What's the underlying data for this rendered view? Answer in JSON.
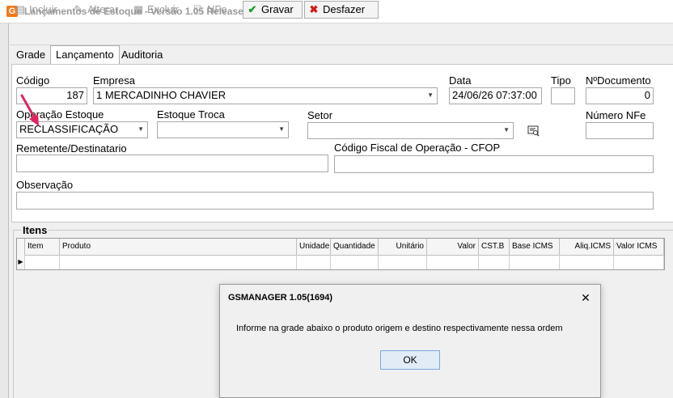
{
  "window": {
    "title": "Lançamentos de Estoque - Versão 1.05 Release 1.694",
    "icon": "G"
  },
  "toolbar": {
    "incluir": "Incluir",
    "alterar": "Alterar",
    "excluir": "Excluir",
    "nfe": "NFe",
    "gravar": "Gravar",
    "desfazer": "Desfazer"
  },
  "tabs": [
    {
      "label": "Grade"
    },
    {
      "label": "Lançamento"
    },
    {
      "label": "Auditoria"
    }
  ],
  "form": {
    "codigo_label": "Código",
    "codigo_value": "187",
    "empresa_label": "Empresa",
    "empresa_value": "1 MERCADINHO CHAVIER",
    "data_label": "Data",
    "data_value": "24/06/26 07:37:00",
    "tipo_label": "Tipo",
    "tipo_value": "",
    "ndoc_label": "NºDocumento",
    "ndoc_value": "0",
    "operacao_label": "Operação Estoque",
    "operacao_value": "RECLASSIFICAÇÃO",
    "troca_label": "Estoque Troca",
    "troca_value": "",
    "setor_label": "Setor",
    "setor_value": "",
    "nfe_label": "Número NFe",
    "nfe_value": "",
    "remetente_label": "Remetente/Destinatario",
    "remetente_value": "",
    "cfop_label": "Código Fiscal de Operação - CFOP",
    "cfop_value": "",
    "obs_label": "Observação",
    "obs_value": ""
  },
  "itens": {
    "title": "Itens",
    "columns": [
      "Item",
      "Produto",
      "Unidade",
      "Quantidade",
      "Unitário",
      "Valor",
      "CST.B",
      "Base ICMS",
      "Aliq.ICMS",
      "Valor ICMS"
    ]
  },
  "dialog": {
    "title": "GSMANAGER  1.05(1694)",
    "message": "Informe na grade abaixo o produto origem e destino respectivamente nessa ordem",
    "ok_label": "OK"
  },
  "colors": {
    "accent": "#e0245e",
    "app_icon": "#f27a1a",
    "ok_button": "#e1ecf7"
  }
}
